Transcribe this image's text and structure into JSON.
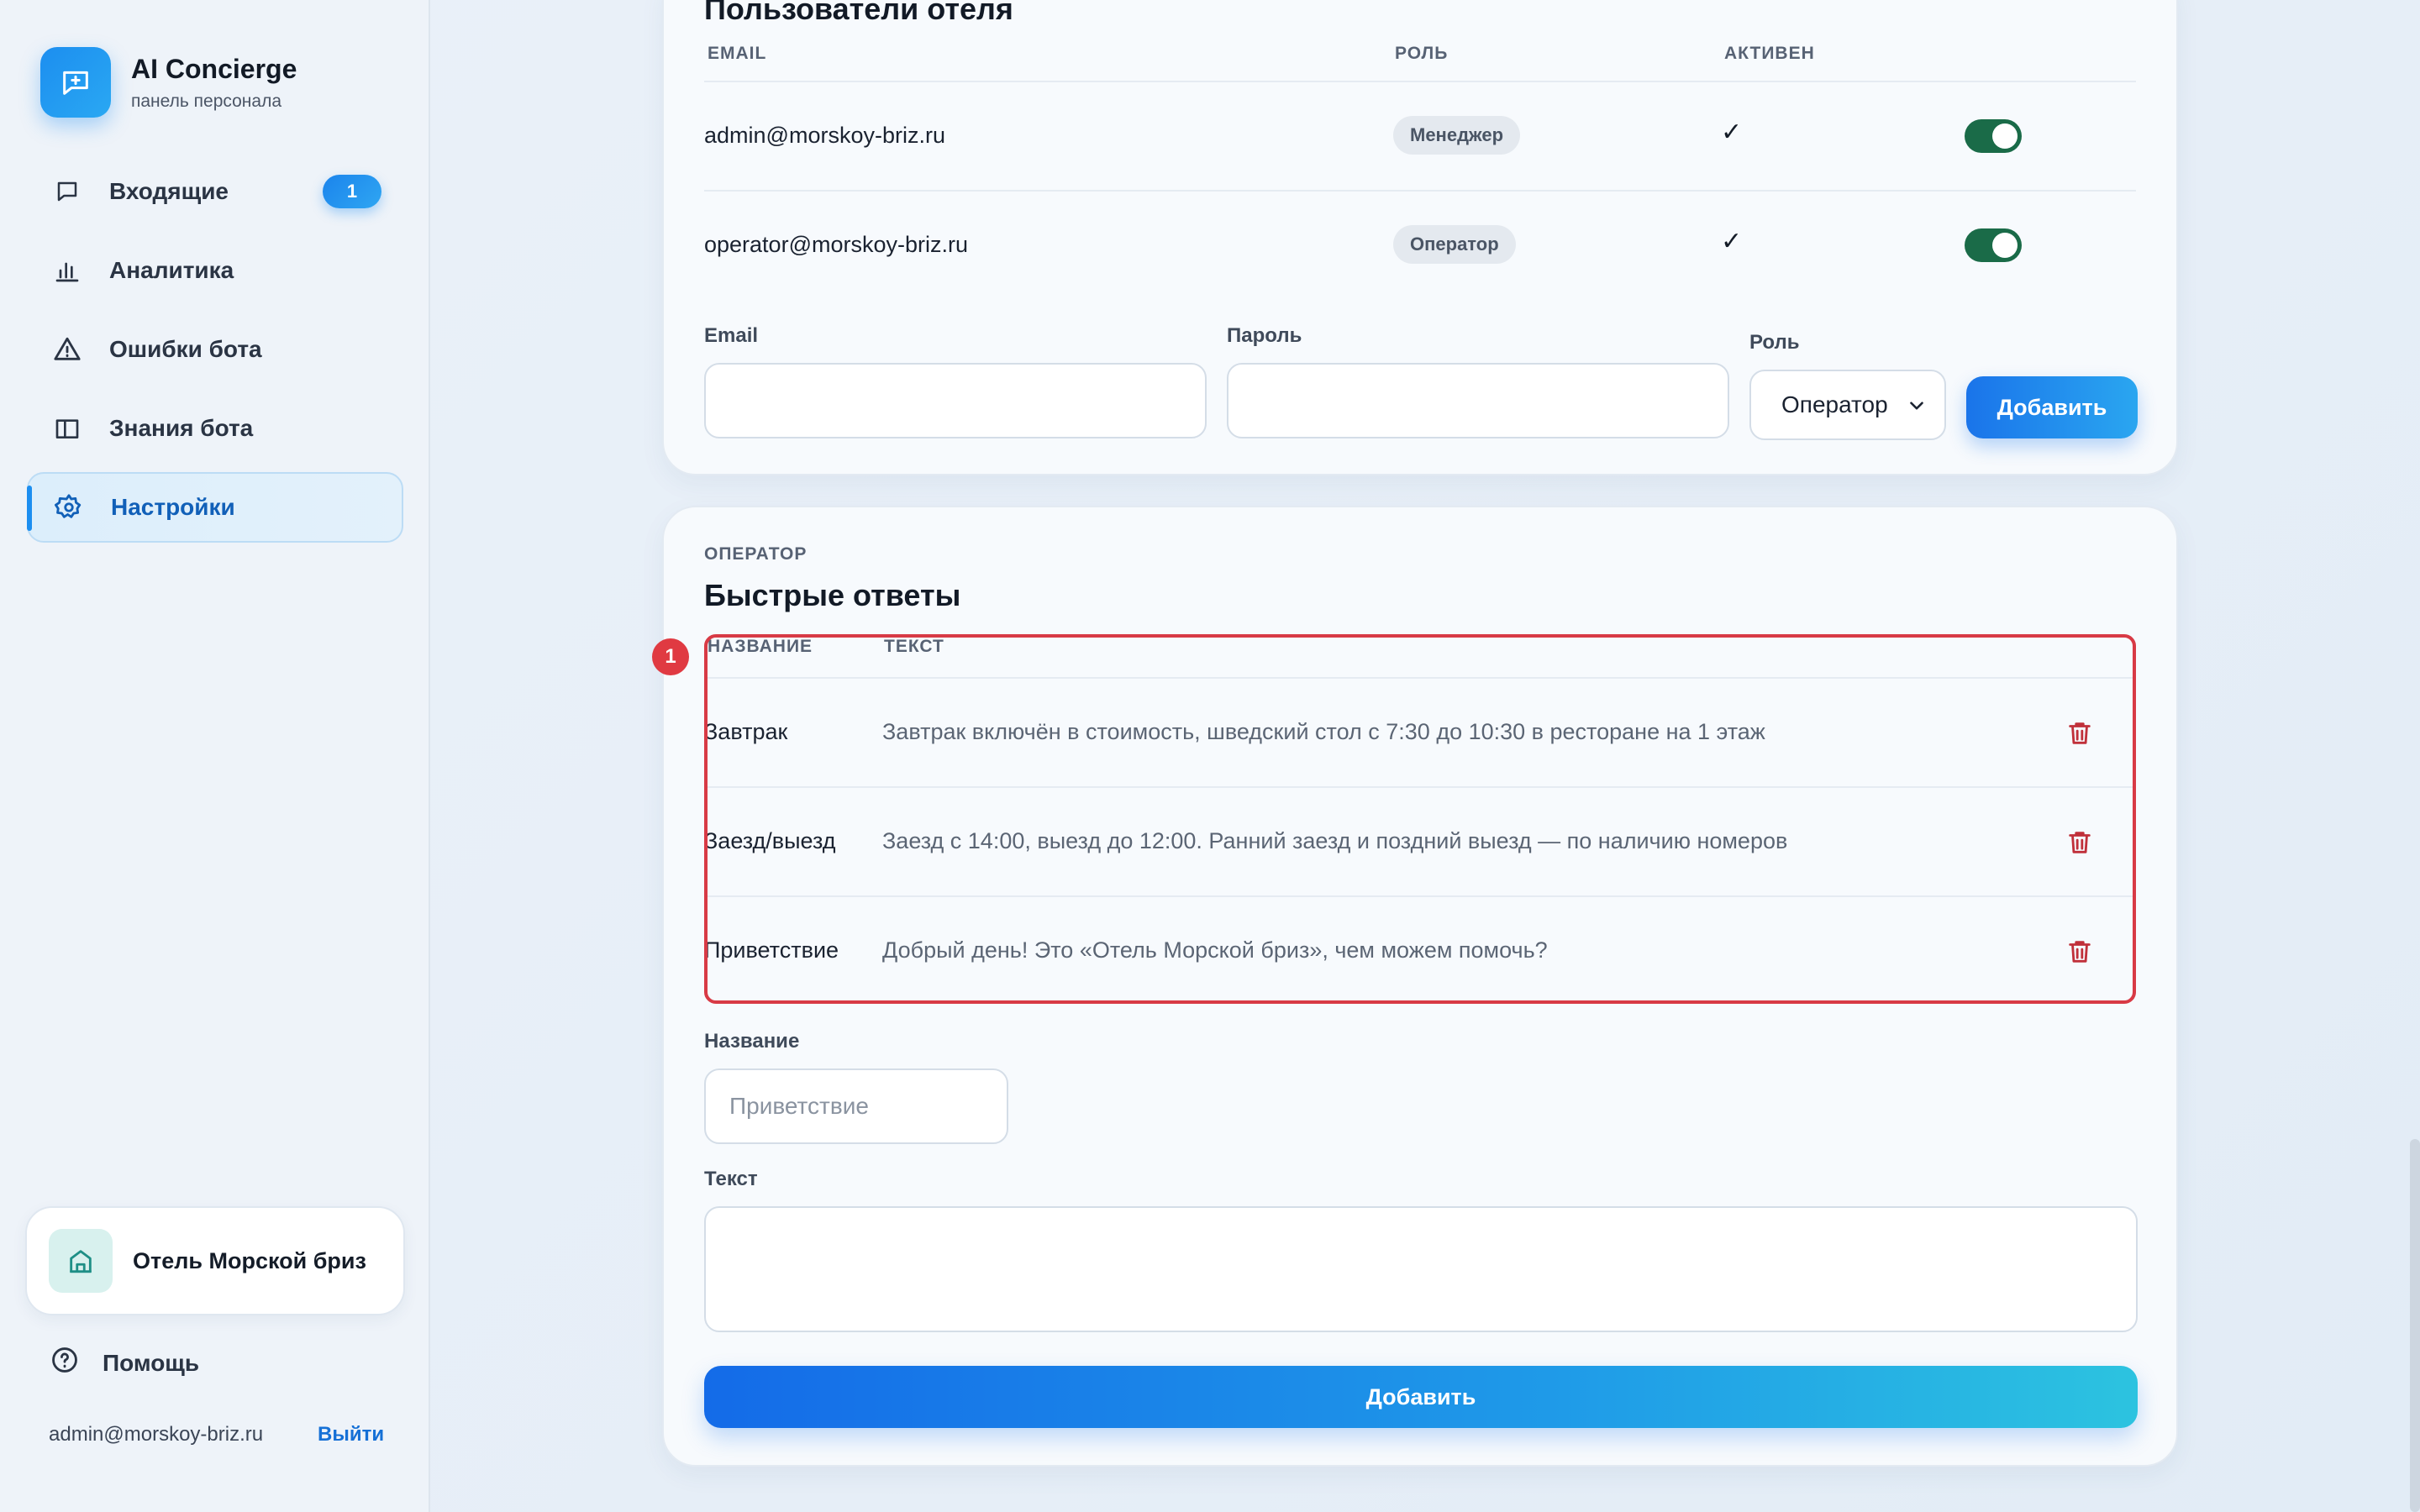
{
  "brand": {
    "title": "AI Concierge",
    "subtitle": "панель персонала"
  },
  "nav": {
    "inbox": "Входящие",
    "inbox_badge": "1",
    "analytics": "Аналитика",
    "errors": "Ошибки бота",
    "knowledge": "Знания бота",
    "settings": "Настройки"
  },
  "hotel": {
    "name": "Отель Морской бриз"
  },
  "footer": {
    "help": "Помощь",
    "user_email": "admin@morskoy-briz.ru",
    "logout": "Выйти"
  },
  "users": {
    "title": "Пользователи отеля",
    "headers": {
      "email": "EMAIL",
      "role": "РОЛЬ",
      "active": "АКТИВЕН"
    },
    "rows": [
      {
        "email": "admin@morskoy-briz.ru",
        "role": "Менеджер",
        "active_mark": "✓",
        "enabled": true
      },
      {
        "email": "operator@morskoy-briz.ru",
        "role": "Оператор",
        "active_mark": "✓",
        "enabled": true
      }
    ],
    "form": {
      "email_label": "Email",
      "email_value": "",
      "password_label": "Пароль",
      "password_value": "",
      "role_label": "Роль",
      "role_value": "Оператор",
      "add_button": "Добавить"
    }
  },
  "quick": {
    "eyebrow": "ОПЕРАТОР",
    "title": "Быстрые ответы",
    "headers": {
      "name": "НАЗВАНИЕ",
      "text": "ТЕКСТ"
    },
    "rows": [
      {
        "name": "Завтрак",
        "text": "Завтрак включён в стоимость, шведский стол с 7:30 до 10:30 в ресторане на 1 этаж"
      },
      {
        "name": "Заезд/выезд",
        "text": "Заезд с 14:00, выезд до 12:00. Ранний заезд и поздний выезд — по наличию номеров"
      },
      {
        "name": "Приветствие",
        "text": "Добрый день! Это «Отель Морской бриз», чем можем помочь?"
      }
    ],
    "form": {
      "name_label": "Название",
      "name_placeholder": "Приветствие",
      "text_label": "Текст",
      "add_button": "Добавить"
    },
    "annotation_number": "1"
  },
  "colors": {
    "accent": "#1c8ef0",
    "toggle_on": "#1a6b48",
    "danger": "#c0303a",
    "highlight": "#d83a45"
  }
}
